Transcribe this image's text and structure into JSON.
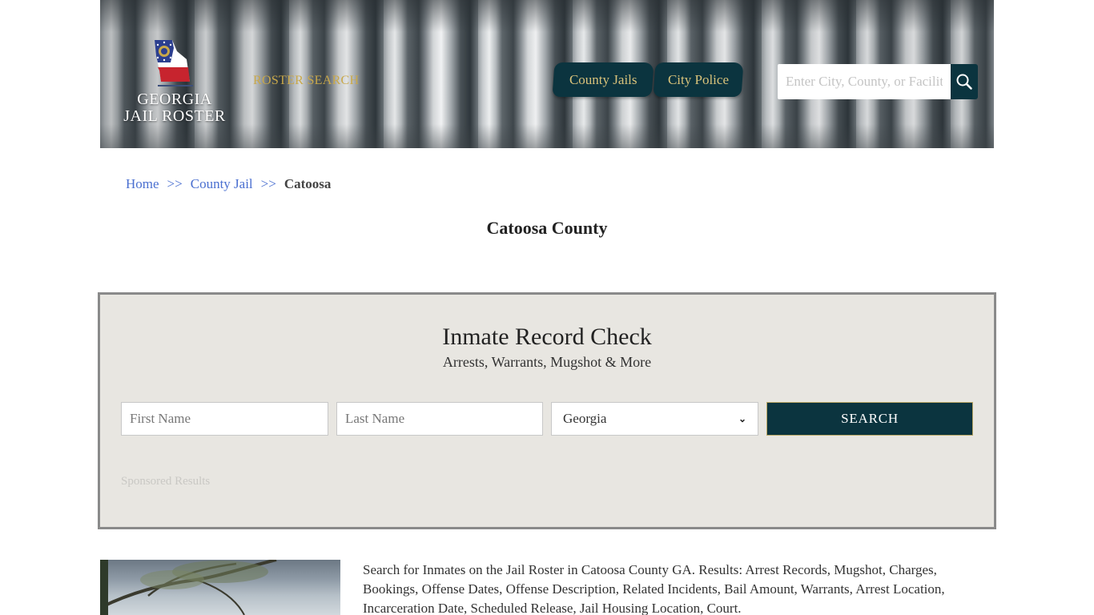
{
  "header": {
    "logo_line1": "GEORGIA",
    "logo_line2": "JAIL ROSTER",
    "roster_search": "ROSTER SEARCH",
    "nav_tabs": [
      {
        "label": "County Jails"
      },
      {
        "label": "City Police"
      }
    ],
    "search": {
      "placeholder": "Enter City, County, or Facility",
      "value": ""
    },
    "colors": {
      "nav_bg": "#0b343f",
      "nav_text": "#d8c27a",
      "roster_search": "#c9a84a"
    }
  },
  "breadcrumb": {
    "items": [
      {
        "label": "Home"
      },
      {
        "label": "County Jail"
      }
    ],
    "separator": ">>",
    "current": "Catoosa"
  },
  "page_title": "Catoosa County",
  "record_check": {
    "title": "Inmate Record Check",
    "subtitle": "Arrests, Warrants, Mugshot & More",
    "first_name_placeholder": "First Name",
    "last_name_placeholder": "Last Name",
    "state_selected": "Georgia",
    "search_button": "SEARCH",
    "sponsored": "Sponsored Results"
  },
  "description": "Search for Inmates on the Jail Roster in Catoosa County GA. Results: Arrest Records, Mugshot, Charges, Bookings, Offense Dates, Offense Description, Related Incidents, Bail Amount, Warrants, Arrest Location, Incarceration Date, Scheduled Release, Jail Housing Location, Court."
}
